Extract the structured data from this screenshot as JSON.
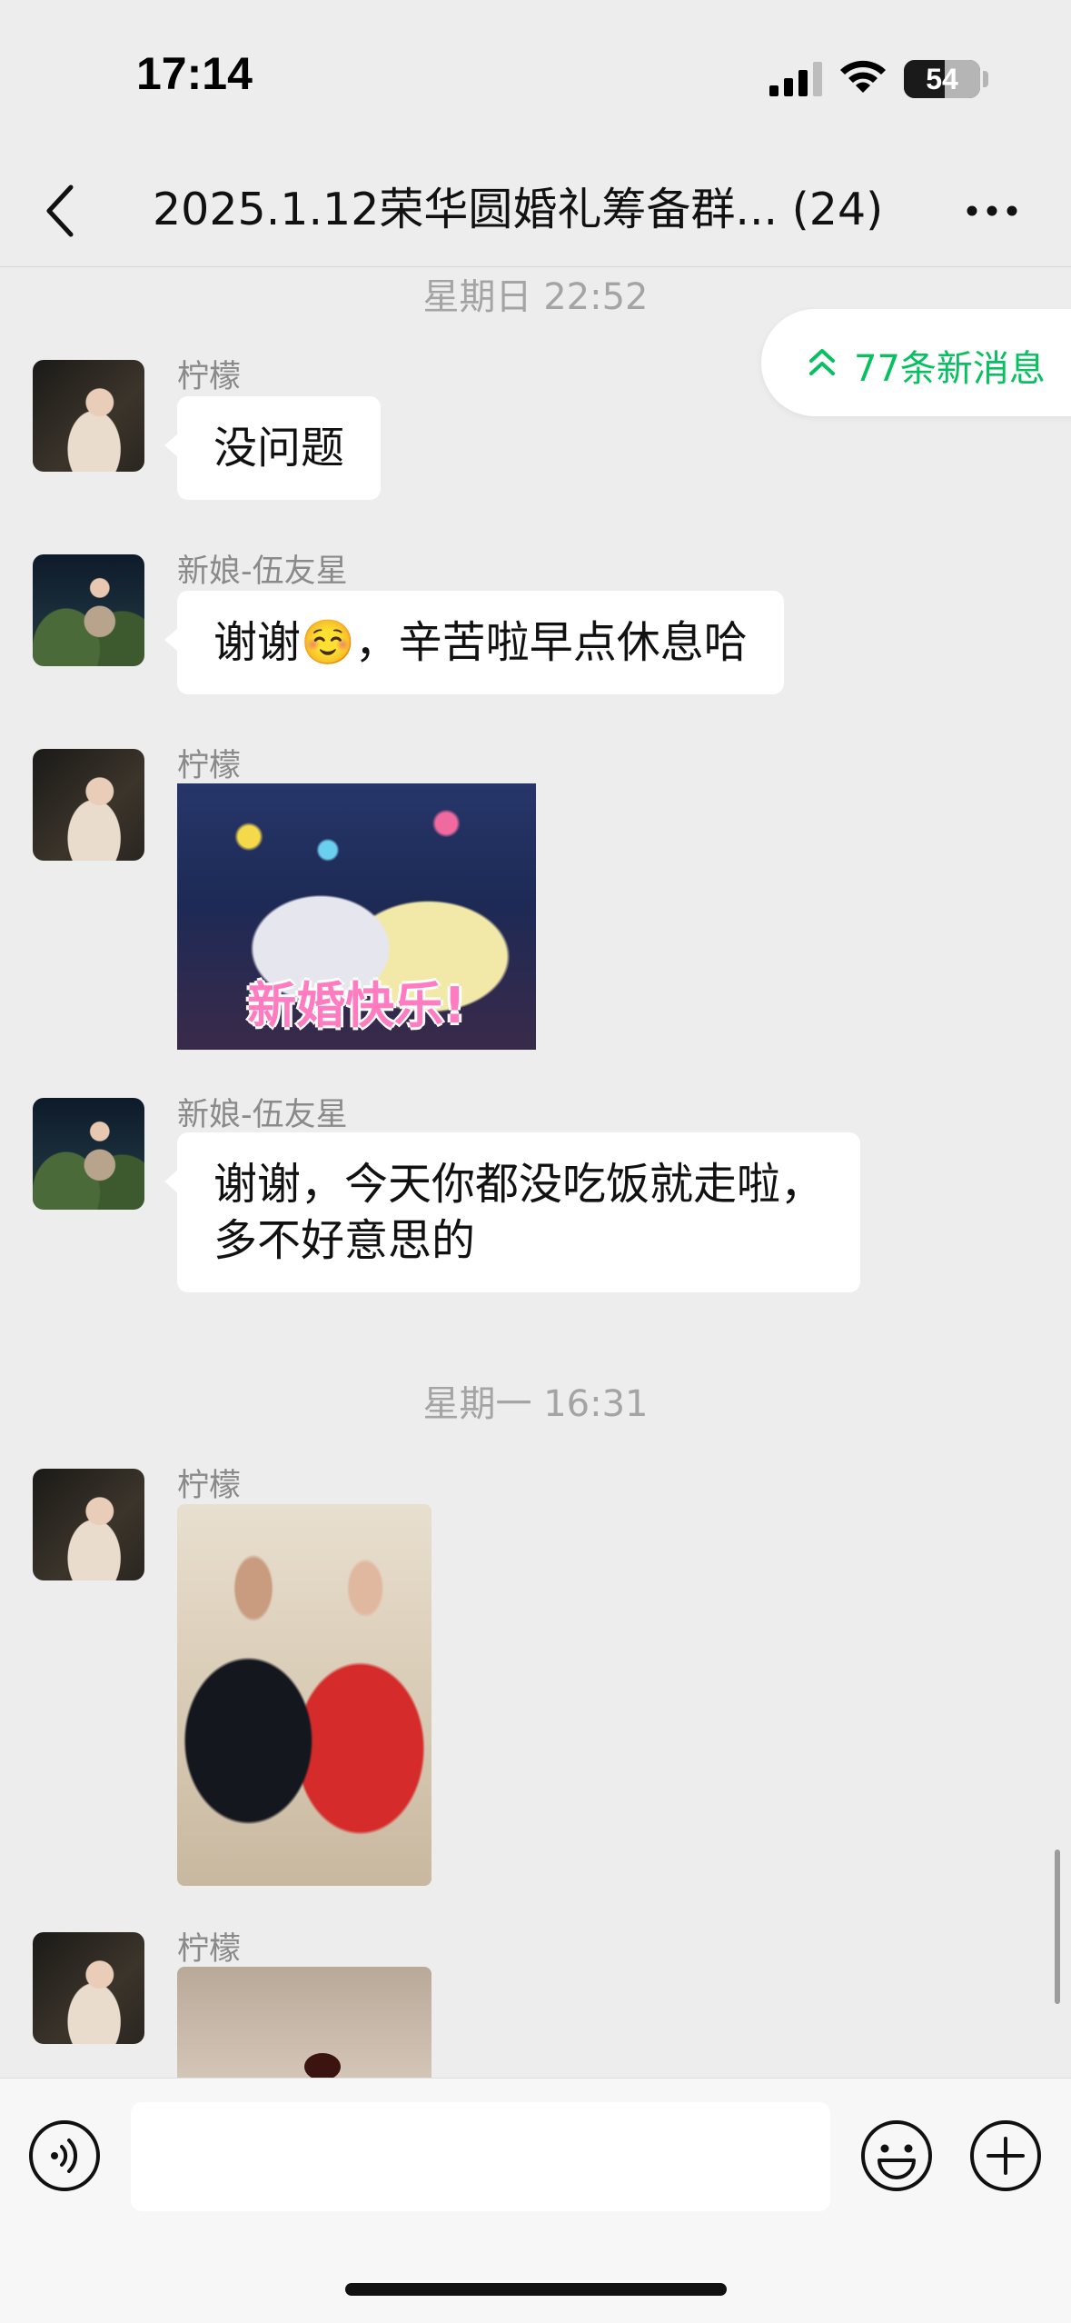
{
  "status_bar": {
    "time": "17:14",
    "battery_level": "54",
    "battery_fraction": 0.54
  },
  "header": {
    "title": "2025.1.12荣华圆婚礼筹备群... (24)",
    "back_icon": "chevron-left-icon",
    "more_icon": "more-dots-icon"
  },
  "new_messages": {
    "label": "77条新消息",
    "icon": "double-chevron-up-icon",
    "color": "#07c160"
  },
  "messages": [
    {
      "type": "time",
      "text": "星期日 22:52"
    },
    {
      "type": "text",
      "sender": "柠檬",
      "text": "没问题"
    },
    {
      "type": "text",
      "sender": "新娘-伍友星",
      "text": "谢谢☺️，辛苦啦早点休息哈"
    },
    {
      "type": "sticker",
      "sender": "柠檬",
      "caption": "新婚快乐!"
    },
    {
      "type": "text",
      "sender": "新娘-伍友星",
      "text_line1": "谢谢，今天你都没吃饭就走啦，",
      "text_line2": "多不好意思的"
    },
    {
      "type": "time",
      "text": "星期一 16:31"
    },
    {
      "type": "image",
      "sender": "柠檬"
    },
    {
      "type": "image",
      "sender": "柠檬"
    }
  ],
  "input_bar": {
    "text_value": "",
    "voice_icon": "voice-icon",
    "emoji_icon": "emoji-icon",
    "plus_icon": "plus-icon"
  },
  "colors": {
    "background": "#ededed",
    "bubble": "#ffffff",
    "accent": "#07c160"
  }
}
